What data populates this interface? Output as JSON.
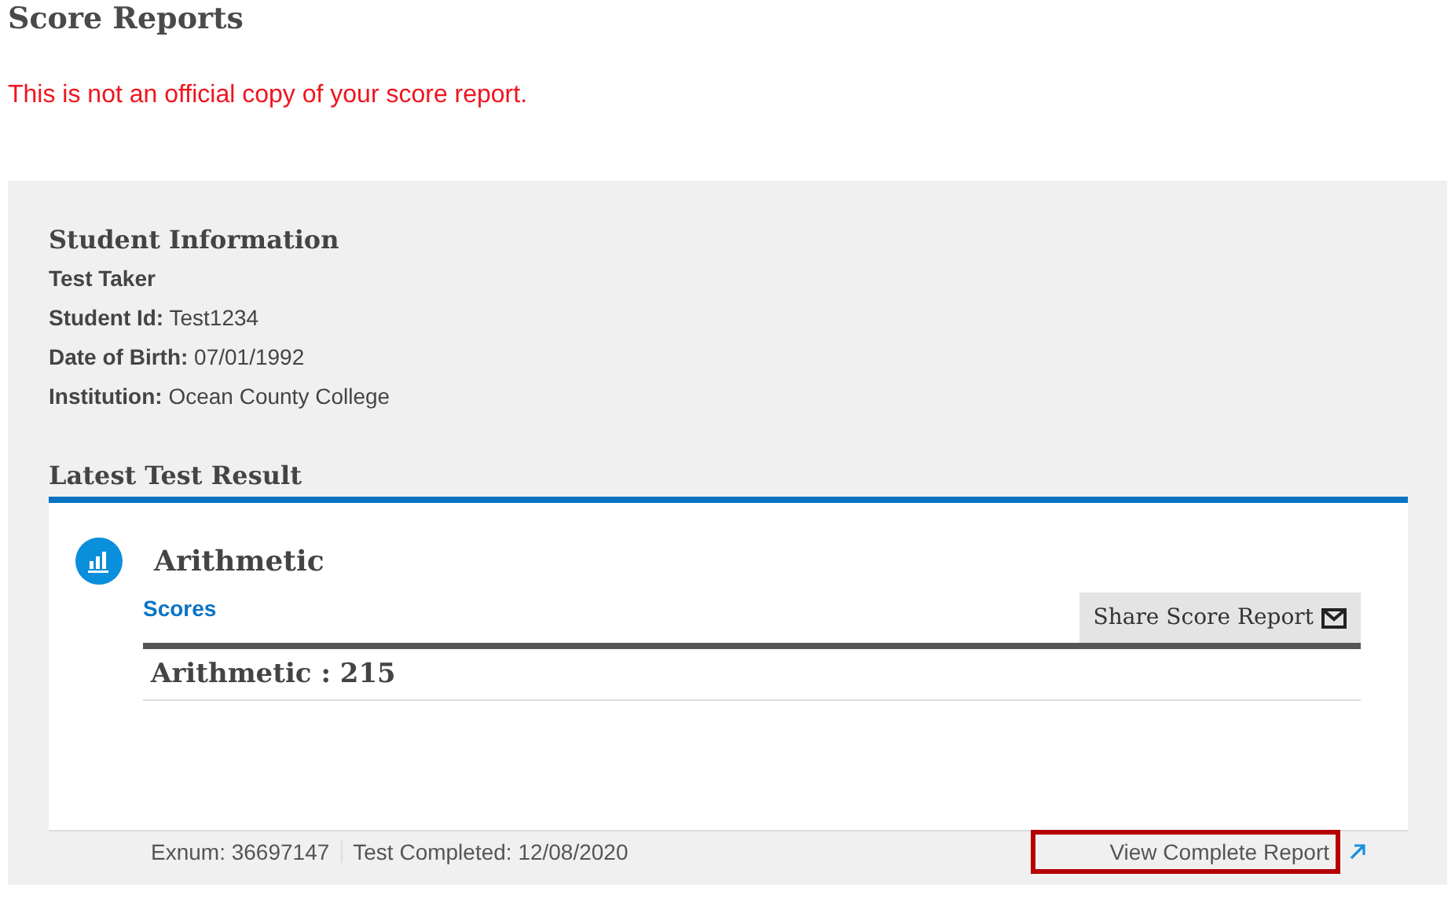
{
  "page_title": "Score Reports",
  "notice": "This is not an official copy of your score report.",
  "student_info": {
    "heading": "Student Information",
    "name": "Test Taker",
    "fields": [
      "**Student Id:** Test1234",
      "**Date of Birth:** 07/01/1992",
      "**Institution:** Ocean County College"
    ]
  },
  "latest_result": {
    "heading": "Latest Test Result",
    "test_name": "Arithmetic",
    "scores_link": "Scores",
    "share_button": "Share Score Report",
    "score_line": "Arithmetic : 215",
    "footer": {
      "exnum": "Exnum: 36697147",
      "completed": "Test Completed: 12/08/2020",
      "report_link": "View Complete Report",
      "highlighted": true
    }
  }
}
